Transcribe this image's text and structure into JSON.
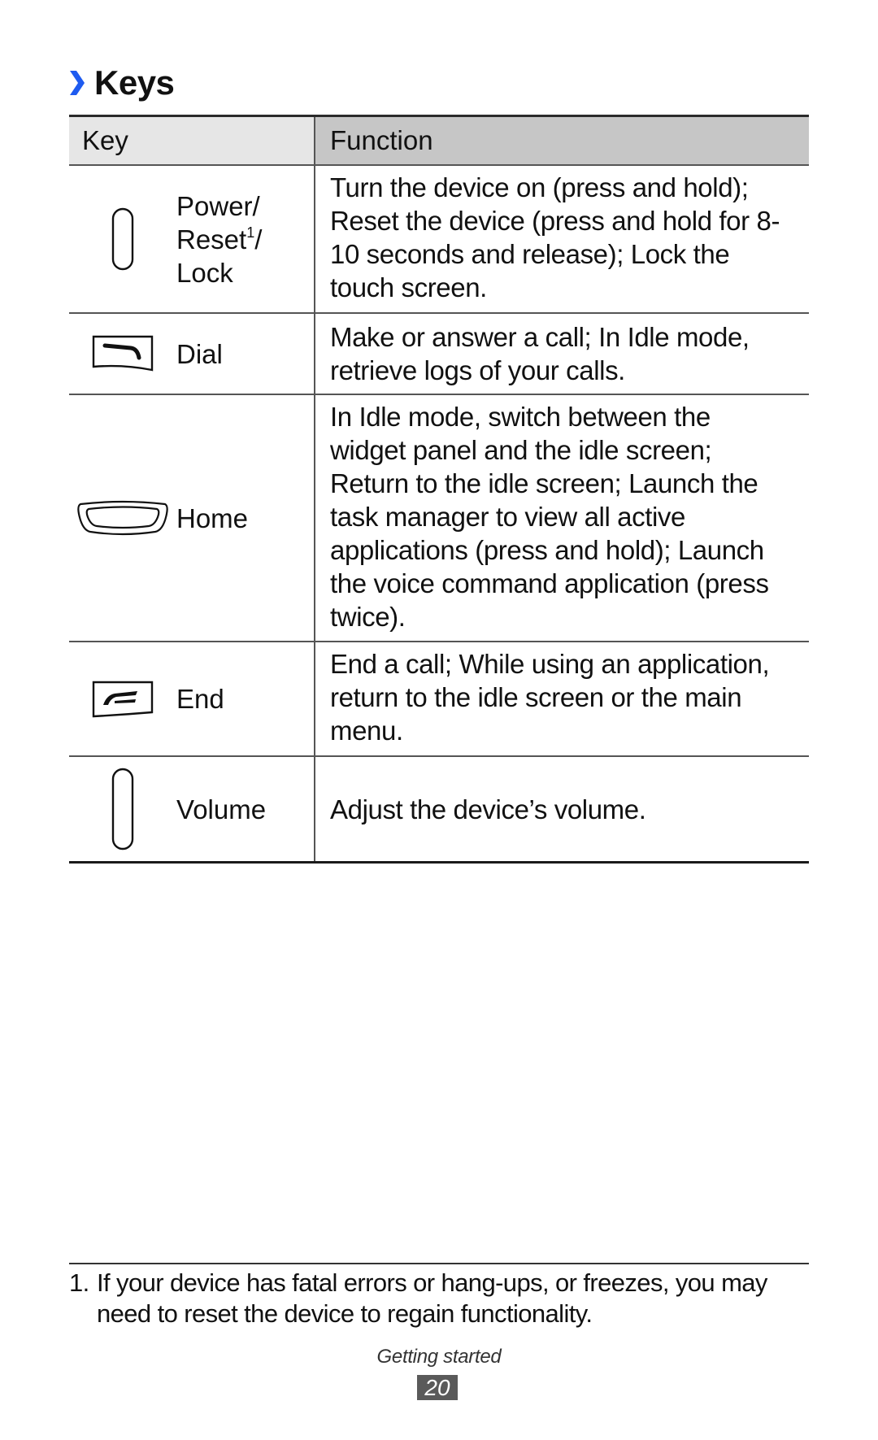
{
  "section": {
    "icon": "chevron-right-icon",
    "title": "Keys",
    "accent_color": "#1e5bf0"
  },
  "table": {
    "headers": {
      "key": "Key",
      "function": "Function"
    },
    "rows": [
      {
        "icon": "power-key-icon",
        "key_lines": [
          "Power/",
          "Reset",
          "/",
          "Lock"
        ],
        "footnote_ref": "1",
        "function": "Turn the device on (press and hold); Reset the device (press and hold for 8-10 seconds and release); Lock the touch screen."
      },
      {
        "icon": "dial-key-icon",
        "key": "Dial",
        "function": "Make or answer a call; In Idle mode, retrieve logs of your calls."
      },
      {
        "icon": "home-key-icon",
        "key": "Home",
        "function": "In Idle mode, switch between the widget panel and the idle screen; Return to the idle screen; Launch the task manager to view all active applications (press and hold); Launch the voice command application (press twice)."
      },
      {
        "icon": "end-key-icon",
        "key": "End",
        "function": "End a call; While using an application, return to the idle screen or the main menu."
      },
      {
        "icon": "volume-key-icon",
        "key": "Volume",
        "function": "Adjust the device’s volume."
      }
    ]
  },
  "footnote": {
    "number": "1.",
    "text": "If your device has fatal errors or hang-ups, or freezes, you may need to reset the device to regain functionality."
  },
  "footer": {
    "section_label": "Getting started",
    "page_number": "20"
  }
}
